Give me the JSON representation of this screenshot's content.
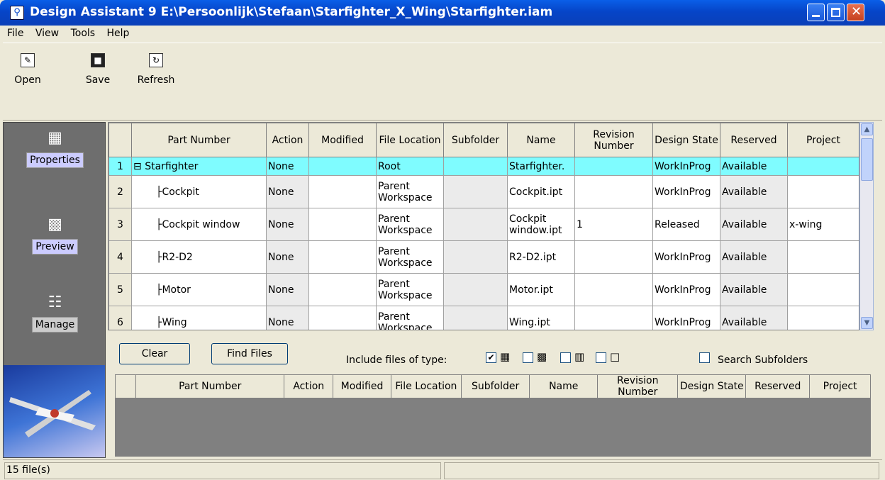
{
  "window": {
    "title": "Design Assistant 9 E:\\Persoonlijk\\Stefaan\\Starfighter_X_Wing\\Starfighter.iam",
    "icon": "app-icon"
  },
  "menu": [
    "File",
    "View",
    "Tools",
    "Help"
  ],
  "toolbar": {
    "open_label": "Open",
    "save_label": "Save",
    "refresh_label": "Refresh"
  },
  "sidebar": {
    "properties_label": "Properties",
    "preview_label": "Preview",
    "manage_label": "Manage"
  },
  "grid": {
    "columns": [
      "Part Number",
      "Action",
      "Modified",
      "File Location",
      "Subfolder",
      "Name",
      "Revision Number",
      "Design State",
      "Reserved",
      "Project"
    ],
    "rows": [
      {
        "num": "1",
        "part": "Starfighter",
        "action": "None",
        "modified": "",
        "location": "Root",
        "subfolder": "",
        "name": "Starfighter.",
        "revision": "",
        "state": "WorkInProg",
        "reserved": "Available",
        "project": ""
      },
      {
        "num": "2",
        "part": "Cockpit",
        "action": "None",
        "modified": "",
        "location": "Parent Workspace",
        "subfolder": "",
        "name": "Cockpit.ipt",
        "revision": "",
        "state": "WorkInProg",
        "reserved": "Available",
        "project": ""
      },
      {
        "num": "3",
        "part": "Cockpit window",
        "action": "None",
        "modified": "",
        "location": "Parent Workspace",
        "subfolder": "",
        "name": "Cockpit window.ipt",
        "revision": "1",
        "state": "Released",
        "reserved": "Available",
        "project": "x-wing"
      },
      {
        "num": "4",
        "part": "R2-D2",
        "action": "None",
        "modified": "",
        "location": "Parent Workspace",
        "subfolder": "",
        "name": "R2-D2.ipt",
        "revision": "",
        "state": "WorkInProg",
        "reserved": "Available",
        "project": ""
      },
      {
        "num": "5",
        "part": "Motor",
        "action": "None",
        "modified": "",
        "location": "Parent Workspace",
        "subfolder": "",
        "name": "Motor.ipt",
        "revision": "",
        "state": "WorkInProg",
        "reserved": "Available",
        "project": ""
      },
      {
        "num": "6",
        "part": "Wing",
        "action": "None",
        "modified": "",
        "location": "Parent Workspace",
        "subfolder": "",
        "name": "Wing.ipt",
        "revision": "",
        "state": "WorkInProg",
        "reserved": "Available",
        "project": ""
      }
    ]
  },
  "search": {
    "clear_label": "Clear",
    "find_label": "Find Files",
    "include_label": "Include files of type:",
    "subfolders_label": "Search Subfolders"
  },
  "lower_grid": {
    "columns": [
      "Part Number",
      "Action",
      "Modified",
      "File Location",
      "Subfolder",
      "Name",
      "Revision Number",
      "Design State",
      "Reserved",
      "Project"
    ]
  },
  "status": {
    "file_count": "15 file(s)"
  }
}
